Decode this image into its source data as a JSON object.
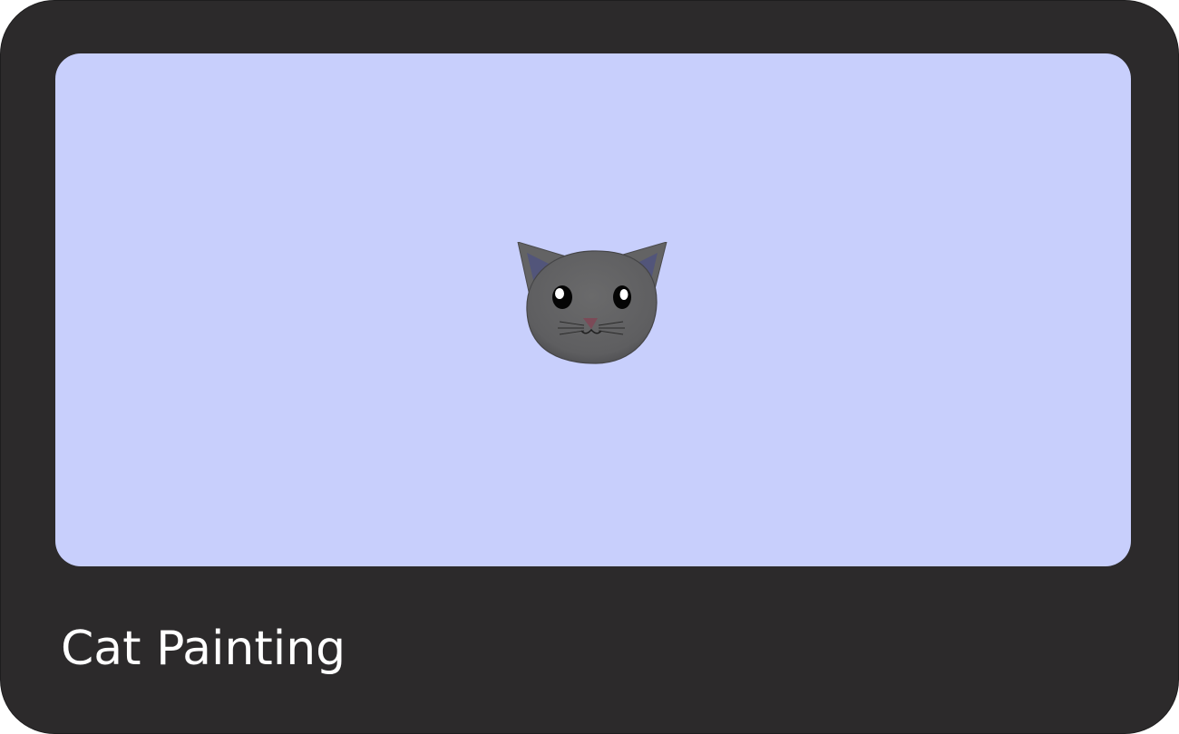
{
  "card": {
    "caption": "Cat Painting"
  },
  "canvas": {
    "background_color": "#c8cffc",
    "subject_icon": "cat-face-icon"
  },
  "colors": {
    "card_background": "#2c2a2b",
    "cat_fur": "#636364",
    "cat_inner_ear": "#52557a",
    "cat_nose": "#7b4a57",
    "caption_text": "#ffffff"
  }
}
